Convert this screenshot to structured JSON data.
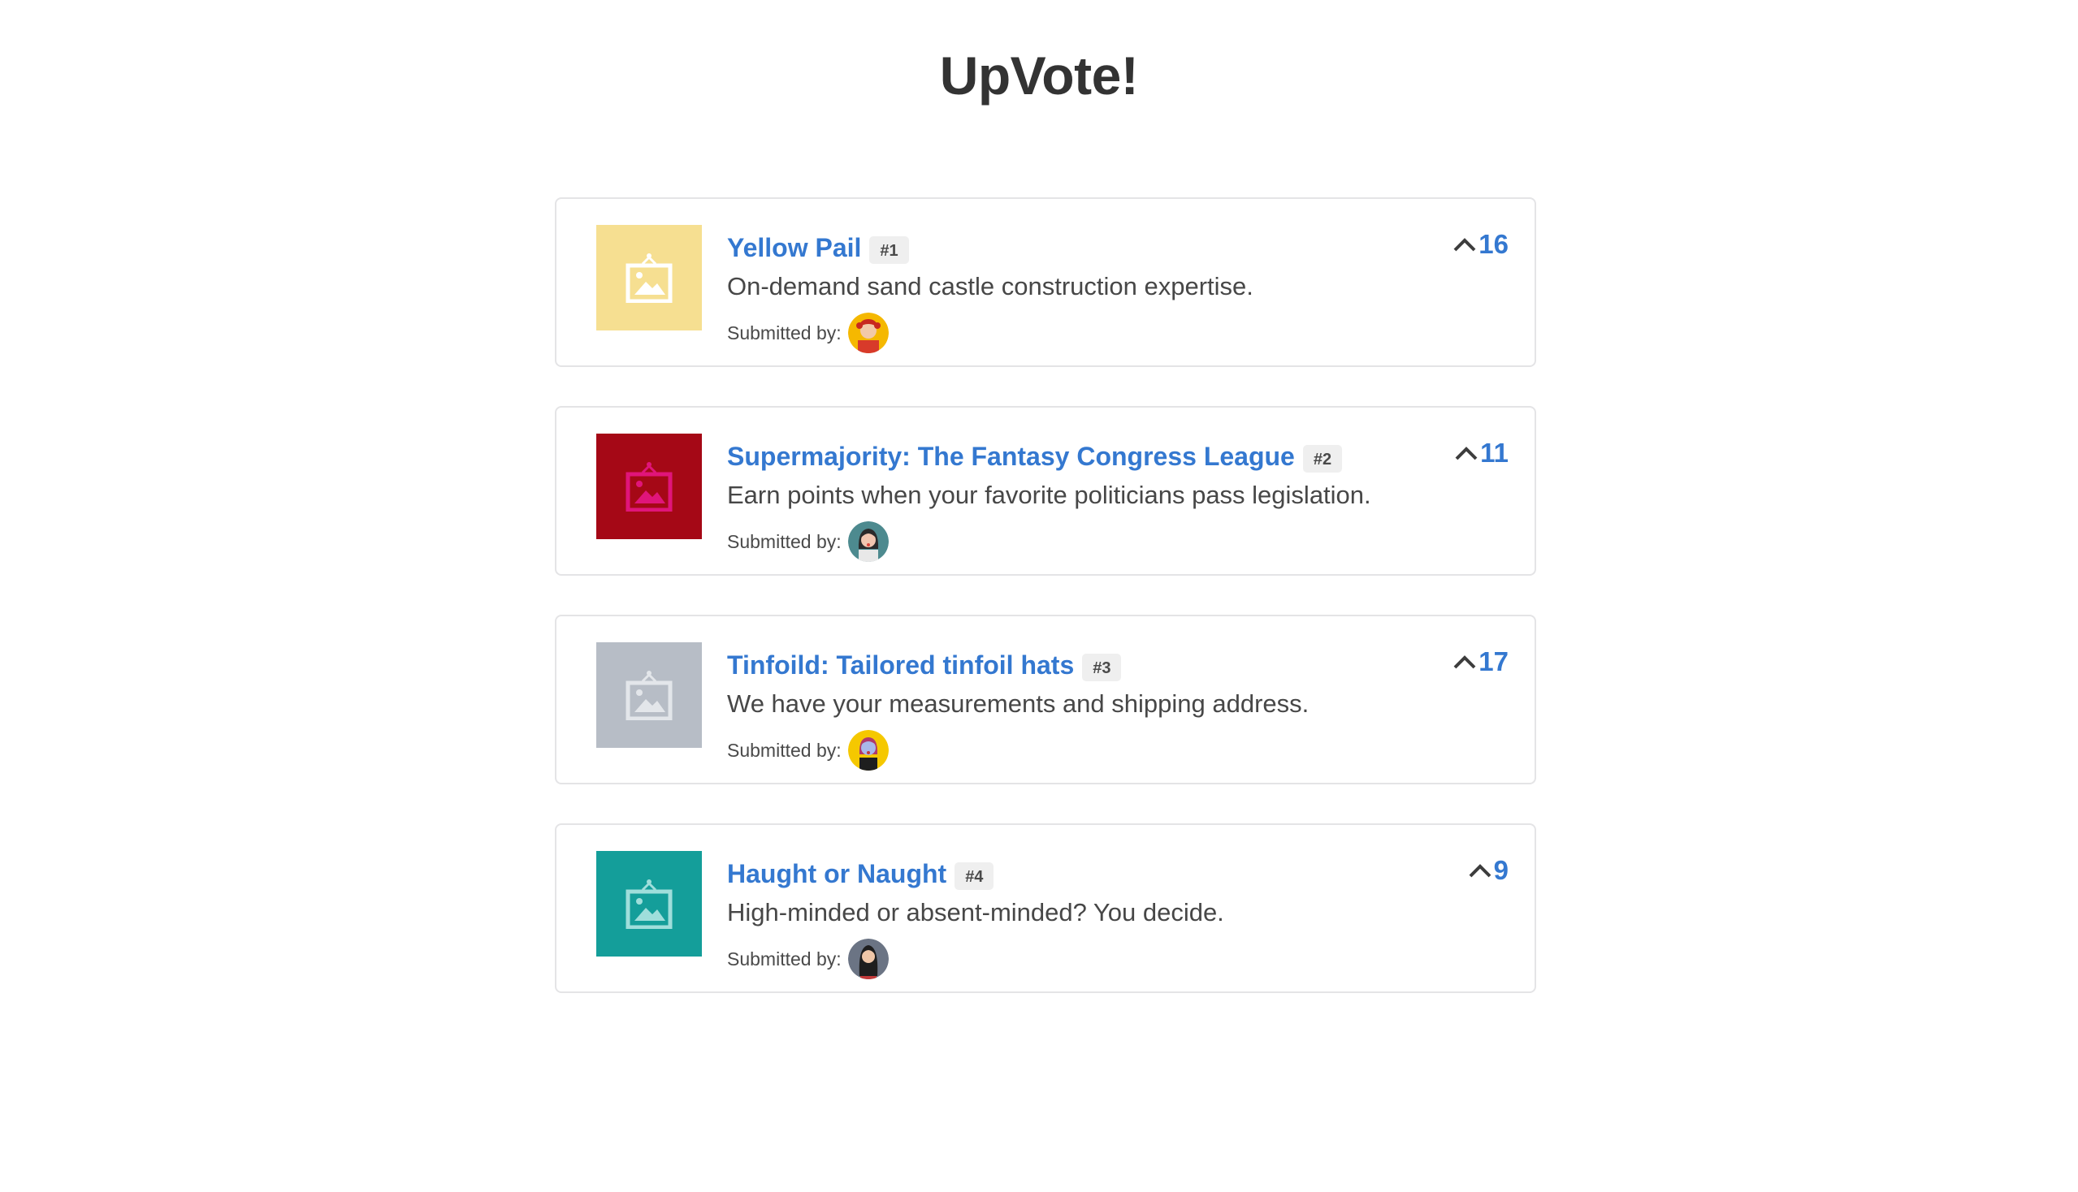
{
  "header": {
    "title": "UpVote!"
  },
  "submitted_label": "Submitted by:",
  "products": [
    {
      "title": "Yellow Pail",
      "rank": "#1",
      "description": "On-demand sand castle construction expertise.",
      "votes": "16",
      "thumb_color": "#f6df91",
      "thumb_icon_color": "#ffffff",
      "avatar_icon": "avatar-red-hair-icon",
      "avatar_bg": "#f5b800"
    },
    {
      "title": "Supermajority: The Fantasy Congress League",
      "rank": "#2",
      "description": "Earn points when your favorite politicians pass legislation.",
      "votes": "11",
      "thumb_color": "#a50816",
      "thumb_icon_color": "#e0157a",
      "avatar_icon": "avatar-dark-hair-icon",
      "avatar_bg": "#4d8a8f"
    },
    {
      "title": "Tinfoild: Tailored tinfoil hats",
      "rank": "#3",
      "description": "We have your measurements and shipping address.",
      "votes": "17",
      "thumb_color": "#b7bdc6",
      "thumb_icon_color": "#e3e6ea",
      "avatar_icon": "avatar-blue-hair-icon",
      "avatar_bg": "#f5c800"
    },
    {
      "title": "Haught or Naught",
      "rank": "#4",
      "description": "High-minded or absent-minded? You decide.",
      "votes": "9",
      "thumb_color": "#149e9a",
      "thumb_icon_color": "#9fdedb",
      "avatar_icon": "avatar-long-hair-icon",
      "avatar_bg": "#6b7484"
    }
  ]
}
